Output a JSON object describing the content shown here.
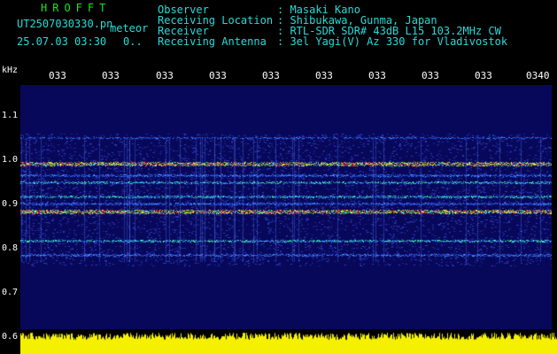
{
  "header": {
    "hrofft": "HROFFT",
    "filename": "UT2507030330.pn",
    "meteor_label": "meteor",
    "datetime": "25.07.03 03:30",
    "count": "0..",
    "fields": [
      {
        "label": "Observer",
        "value": ": Masaki Kano"
      },
      {
        "label": "Receiving Location",
        "value": ": Shibukawa, Gunma, Japan"
      },
      {
        "label": "Receiver",
        "value": ": RTL-SDR SDR# 43dB L15 103.2MHz CW"
      },
      {
        "label": "Receiving Antenna",
        "value": ": 3el Yagi(V) Az 330 for Vladivostok"
      }
    ]
  },
  "axis": {
    "unit": "kHz",
    "x_ticks": [
      "033",
      "033",
      "033",
      "033",
      "033",
      "033",
      "033",
      "033",
      "033",
      "0340"
    ],
    "y_ticks": [
      "1.1",
      "1.0",
      "0.9",
      "0.8",
      "0.7",
      "0.6"
    ]
  },
  "colors": {
    "background": "#000000",
    "plot_bg": "#08085a",
    "amplitude": "#f5f000",
    "title_green": "#19e619",
    "info_cyan": "#2ad9d9"
  }
}
